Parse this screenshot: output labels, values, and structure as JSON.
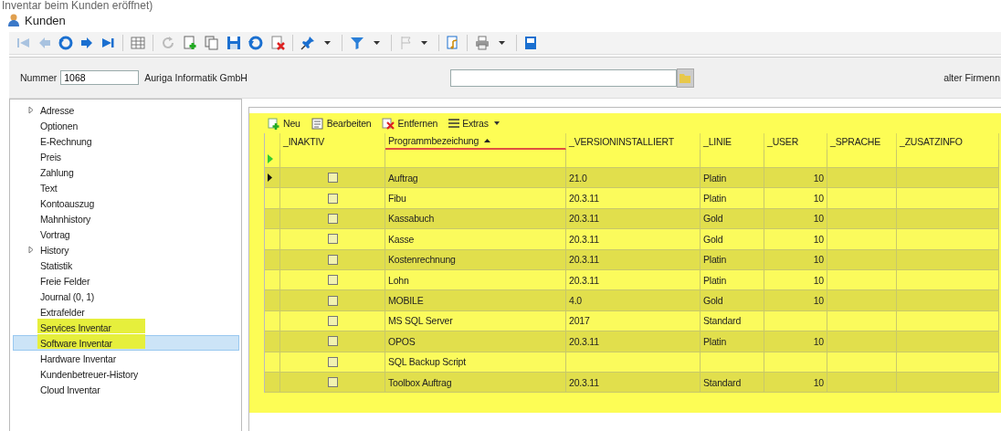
{
  "caption_fragment": "Inventar beim Kunden eröffnet)",
  "window": {
    "title": "Kunden"
  },
  "form": {
    "number_label": "Nummer",
    "number_value": "1068",
    "company_name": "Auriga Informatik GmbH",
    "right_label": "alter Firmenn"
  },
  "sidebar": {
    "items": [
      {
        "label": "Adresse",
        "kind": "group",
        "expanded": false,
        "selected": false,
        "highlighted": false
      },
      {
        "label": "Optionen",
        "kind": "leaf",
        "selected": false,
        "highlighted": false
      },
      {
        "label": "E-Rechnung",
        "kind": "leaf",
        "selected": false,
        "highlighted": false
      },
      {
        "label": "Preis",
        "kind": "leaf",
        "selected": false,
        "highlighted": false
      },
      {
        "label": "Zahlung",
        "kind": "leaf",
        "selected": false,
        "highlighted": false
      },
      {
        "label": "Text",
        "kind": "leaf",
        "selected": false,
        "highlighted": false
      },
      {
        "label": "Kontoauszug",
        "kind": "leaf",
        "selected": false,
        "highlighted": false
      },
      {
        "label": "Mahnhistory",
        "kind": "leaf",
        "selected": false,
        "highlighted": false
      },
      {
        "label": "Vortrag",
        "kind": "leaf",
        "selected": false,
        "highlighted": false
      },
      {
        "label": "History",
        "kind": "group",
        "expanded": false,
        "selected": false,
        "highlighted": false
      },
      {
        "label": "Statistik",
        "kind": "leaf",
        "selected": false,
        "highlighted": false
      },
      {
        "label": "Freie Felder",
        "kind": "leaf",
        "selected": false,
        "highlighted": false
      },
      {
        "label": "Journal (0, 1)",
        "kind": "leaf",
        "selected": false,
        "highlighted": false
      },
      {
        "label": "Extrafelder",
        "kind": "leaf",
        "selected": false,
        "highlighted": false
      },
      {
        "label": "Services Inventar",
        "kind": "leaf",
        "selected": false,
        "highlighted": true
      },
      {
        "label": "Software Inventar",
        "kind": "leaf",
        "selected": true,
        "highlighted": true
      },
      {
        "label": "Hardware Inventar",
        "kind": "leaf",
        "selected": false,
        "highlighted": false
      },
      {
        "label": "Kundenbetreuer-History",
        "kind": "leaf",
        "selected": false,
        "highlighted": false
      },
      {
        "label": "Cloud Inventar",
        "kind": "leaf",
        "selected": false,
        "highlighted": false
      }
    ]
  },
  "grid": {
    "toolbar": [
      {
        "label": "Neu",
        "kind": "new"
      },
      {
        "label": "Bearbeiten",
        "kind": "edit"
      },
      {
        "label": "Entfernen",
        "kind": "delete"
      },
      {
        "label": "Extras",
        "kind": "menu"
      }
    ],
    "columns": [
      {
        "label": "_INAKTIV",
        "sorted": false
      },
      {
        "label": "Programmbezeichung",
        "sorted": true
      },
      {
        "label": "_VERSIONINSTALLIERT",
        "sorted": false
      },
      {
        "label": "_LINIE",
        "sorted": false
      },
      {
        "label": "_USER",
        "sorted": false
      },
      {
        "label": "_SPRACHE",
        "sorted": false
      },
      {
        "label": "_ZUSATZINFO",
        "sorted": false
      }
    ],
    "rows": [
      {
        "current": true,
        "inaktiv": false,
        "name": "Auftrag",
        "version": "21.0",
        "linie": "Platin",
        "user": "10"
      },
      {
        "current": false,
        "inaktiv": false,
        "name": "Fibu",
        "version": "20.3.11",
        "linie": "Platin",
        "user": "10"
      },
      {
        "current": false,
        "inaktiv": false,
        "name": "Kassabuch",
        "version": "20.3.11",
        "linie": "Gold",
        "user": "10"
      },
      {
        "current": false,
        "inaktiv": false,
        "name": "Kasse",
        "version": "20.3.11",
        "linie": "Gold",
        "user": "10"
      },
      {
        "current": false,
        "inaktiv": false,
        "name": "Kostenrechnung",
        "version": "20.3.11",
        "linie": "Platin",
        "user": "10"
      },
      {
        "current": false,
        "inaktiv": false,
        "name": "Lohn",
        "version": "20.3.11",
        "linie": "Platin",
        "user": "10"
      },
      {
        "current": false,
        "inaktiv": false,
        "name": "MOBILE",
        "version": "4.0",
        "linie": "Gold",
        "user": "10"
      },
      {
        "current": false,
        "inaktiv": false,
        "name": "MS SQL Server",
        "version": "2017",
        "linie": "Standard"
      },
      {
        "current": false,
        "inaktiv": false,
        "name": "OPOS",
        "version": "20.3.11",
        "linie": "Platin",
        "user": "10"
      },
      {
        "current": false,
        "inaktiv": false,
        "name": "SQL Backup Script"
      },
      {
        "current": false,
        "inaktiv": false,
        "name": "Toolbox Auftrag",
        "version": "20.3.11",
        "linie": "Standard",
        "user": "10"
      }
    ]
  }
}
